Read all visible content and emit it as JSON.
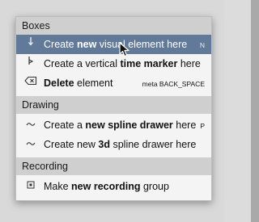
{
  "menu": {
    "sections": [
      {
        "title": "Boxes",
        "items": [
          {
            "icon": "down-arrow-icon",
            "pre": "Create ",
            "bold": "new",
            "post": " visual element here",
            "shortcut": "N"
          },
          {
            "icon": "time-marker-icon",
            "pre": "Create a vertical ",
            "bold": "time marker",
            "post": " here",
            "shortcut": ""
          },
          {
            "icon": "backspace-icon",
            "pre": "",
            "bold": "Delete",
            "post": " element",
            "shortcut": "meta BACK_SPACE"
          }
        ]
      },
      {
        "title": "Drawing",
        "items": [
          {
            "icon": "tilde-icon",
            "pre": "Create a ",
            "bold": "new spline drawer",
            "post": " here",
            "shortcut": "P"
          },
          {
            "icon": "tilde-icon",
            "pre": "Create new ",
            "bold": "3d",
            "post": " spline drawer here",
            "shortcut": ""
          }
        ]
      },
      {
        "title": "Recording",
        "items": [
          {
            "icon": "record-group-icon",
            "pre": "Make ",
            "bold": "new recording",
            "post": " group",
            "shortcut": ""
          }
        ]
      }
    ]
  },
  "colors": {
    "highlight": "#627a99",
    "section_bg": "#cfcfcf",
    "menu_bg": "#f4f4f4"
  }
}
